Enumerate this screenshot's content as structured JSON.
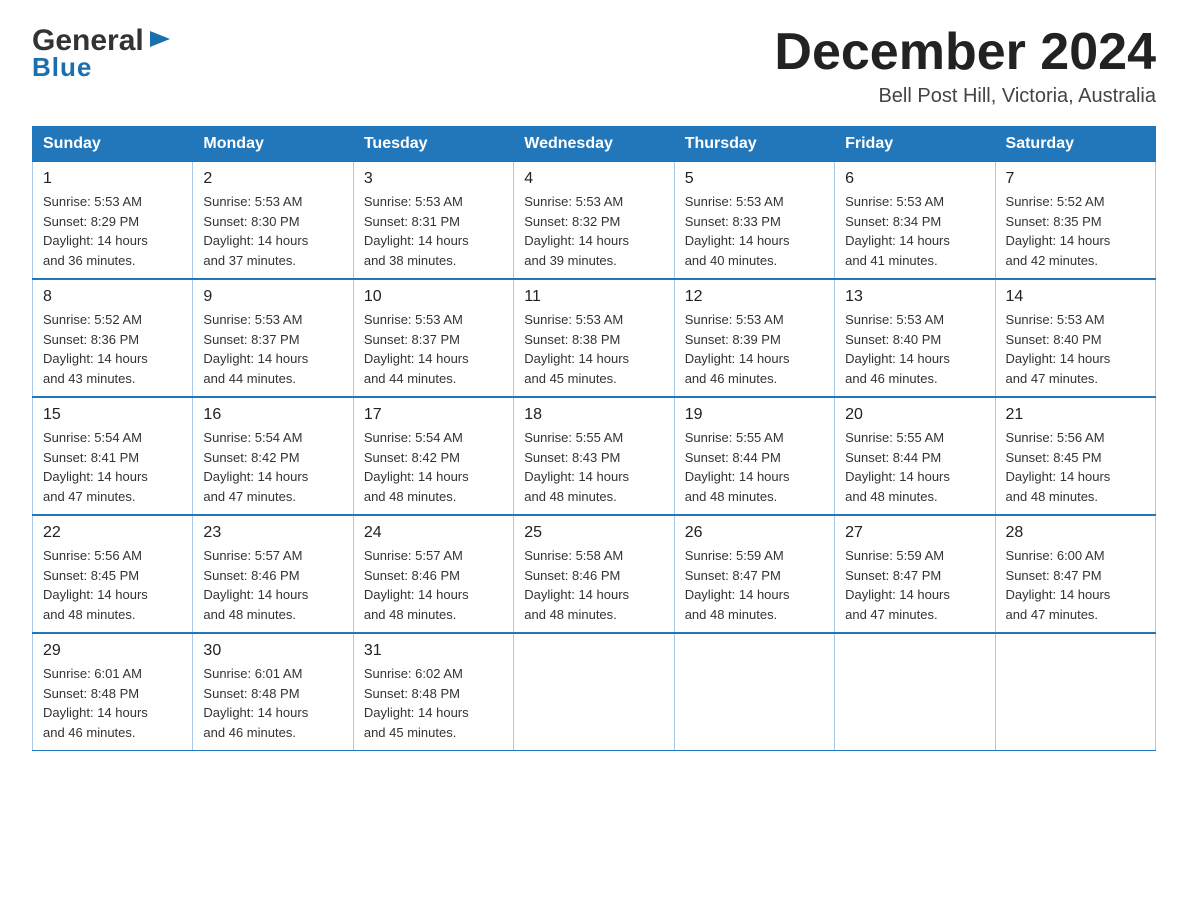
{
  "logo": {
    "general": "General",
    "blue": "Blue",
    "arrow": "▶"
  },
  "title": "December 2024",
  "subtitle": "Bell Post Hill, Victoria, Australia",
  "days_of_week": [
    "Sunday",
    "Monday",
    "Tuesday",
    "Wednesday",
    "Thursday",
    "Friday",
    "Saturday"
  ],
  "weeks": [
    [
      {
        "num": "1",
        "info": "Sunrise: 5:53 AM\nSunset: 8:29 PM\nDaylight: 14 hours\nand 36 minutes."
      },
      {
        "num": "2",
        "info": "Sunrise: 5:53 AM\nSunset: 8:30 PM\nDaylight: 14 hours\nand 37 minutes."
      },
      {
        "num": "3",
        "info": "Sunrise: 5:53 AM\nSunset: 8:31 PM\nDaylight: 14 hours\nand 38 minutes."
      },
      {
        "num": "4",
        "info": "Sunrise: 5:53 AM\nSunset: 8:32 PM\nDaylight: 14 hours\nand 39 minutes."
      },
      {
        "num": "5",
        "info": "Sunrise: 5:53 AM\nSunset: 8:33 PM\nDaylight: 14 hours\nand 40 minutes."
      },
      {
        "num": "6",
        "info": "Sunrise: 5:53 AM\nSunset: 8:34 PM\nDaylight: 14 hours\nand 41 minutes."
      },
      {
        "num": "7",
        "info": "Sunrise: 5:52 AM\nSunset: 8:35 PM\nDaylight: 14 hours\nand 42 minutes."
      }
    ],
    [
      {
        "num": "8",
        "info": "Sunrise: 5:52 AM\nSunset: 8:36 PM\nDaylight: 14 hours\nand 43 minutes."
      },
      {
        "num": "9",
        "info": "Sunrise: 5:53 AM\nSunset: 8:37 PM\nDaylight: 14 hours\nand 44 minutes."
      },
      {
        "num": "10",
        "info": "Sunrise: 5:53 AM\nSunset: 8:37 PM\nDaylight: 14 hours\nand 44 minutes."
      },
      {
        "num": "11",
        "info": "Sunrise: 5:53 AM\nSunset: 8:38 PM\nDaylight: 14 hours\nand 45 minutes."
      },
      {
        "num": "12",
        "info": "Sunrise: 5:53 AM\nSunset: 8:39 PM\nDaylight: 14 hours\nand 46 minutes."
      },
      {
        "num": "13",
        "info": "Sunrise: 5:53 AM\nSunset: 8:40 PM\nDaylight: 14 hours\nand 46 minutes."
      },
      {
        "num": "14",
        "info": "Sunrise: 5:53 AM\nSunset: 8:40 PM\nDaylight: 14 hours\nand 47 minutes."
      }
    ],
    [
      {
        "num": "15",
        "info": "Sunrise: 5:54 AM\nSunset: 8:41 PM\nDaylight: 14 hours\nand 47 minutes."
      },
      {
        "num": "16",
        "info": "Sunrise: 5:54 AM\nSunset: 8:42 PM\nDaylight: 14 hours\nand 47 minutes."
      },
      {
        "num": "17",
        "info": "Sunrise: 5:54 AM\nSunset: 8:42 PM\nDaylight: 14 hours\nand 48 minutes."
      },
      {
        "num": "18",
        "info": "Sunrise: 5:55 AM\nSunset: 8:43 PM\nDaylight: 14 hours\nand 48 minutes."
      },
      {
        "num": "19",
        "info": "Sunrise: 5:55 AM\nSunset: 8:44 PM\nDaylight: 14 hours\nand 48 minutes."
      },
      {
        "num": "20",
        "info": "Sunrise: 5:55 AM\nSunset: 8:44 PM\nDaylight: 14 hours\nand 48 minutes."
      },
      {
        "num": "21",
        "info": "Sunrise: 5:56 AM\nSunset: 8:45 PM\nDaylight: 14 hours\nand 48 minutes."
      }
    ],
    [
      {
        "num": "22",
        "info": "Sunrise: 5:56 AM\nSunset: 8:45 PM\nDaylight: 14 hours\nand 48 minutes."
      },
      {
        "num": "23",
        "info": "Sunrise: 5:57 AM\nSunset: 8:46 PM\nDaylight: 14 hours\nand 48 minutes."
      },
      {
        "num": "24",
        "info": "Sunrise: 5:57 AM\nSunset: 8:46 PM\nDaylight: 14 hours\nand 48 minutes."
      },
      {
        "num": "25",
        "info": "Sunrise: 5:58 AM\nSunset: 8:46 PM\nDaylight: 14 hours\nand 48 minutes."
      },
      {
        "num": "26",
        "info": "Sunrise: 5:59 AM\nSunset: 8:47 PM\nDaylight: 14 hours\nand 48 minutes."
      },
      {
        "num": "27",
        "info": "Sunrise: 5:59 AM\nSunset: 8:47 PM\nDaylight: 14 hours\nand 47 minutes."
      },
      {
        "num": "28",
        "info": "Sunrise: 6:00 AM\nSunset: 8:47 PM\nDaylight: 14 hours\nand 47 minutes."
      }
    ],
    [
      {
        "num": "29",
        "info": "Sunrise: 6:01 AM\nSunset: 8:48 PM\nDaylight: 14 hours\nand 46 minutes."
      },
      {
        "num": "30",
        "info": "Sunrise: 6:01 AM\nSunset: 8:48 PM\nDaylight: 14 hours\nand 46 minutes."
      },
      {
        "num": "31",
        "info": "Sunrise: 6:02 AM\nSunset: 8:48 PM\nDaylight: 14 hours\nand 45 minutes."
      },
      null,
      null,
      null,
      null
    ]
  ]
}
